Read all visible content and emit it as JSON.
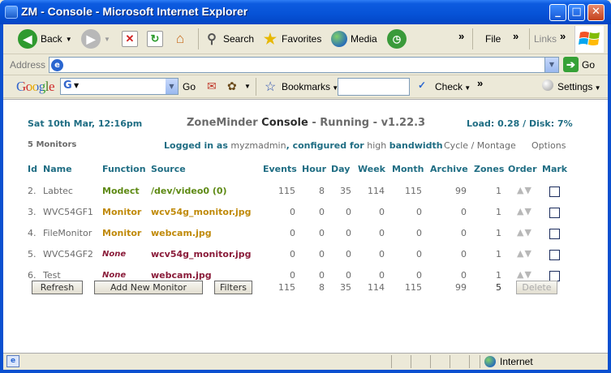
{
  "window": {
    "title": "ZM - Console - Microsoft Internet Explorer",
    "minimize": "_",
    "maximize": "□",
    "close": "✕"
  },
  "toolbar": {
    "back": "Back",
    "search": "Search",
    "favorites": "Favorites",
    "media": "Media",
    "file": "File",
    "links": "Links",
    "chevron": "»"
  },
  "address": {
    "label": "Address",
    "value": "",
    "go": "Go"
  },
  "google_bar": {
    "logo": "Google",
    "g_icon": "G",
    "go": "Go",
    "bookmarks": "Bookmarks",
    "check": "Check",
    "settings": "Settings",
    "chevron": "»"
  },
  "zm": {
    "datetime": "Sat 10th Mar, 12:16pm",
    "title_app": "ZoneMinder",
    "title_page": "Console",
    "title_sep": "-",
    "status": "Running",
    "version_sep": "-",
    "version": "v1.22.3",
    "load_label": "Load:",
    "load_value": "0.28",
    "slash": "/",
    "disk_label": "Disk:",
    "disk_value": "7%",
    "monitors_count": "5 Monitors",
    "logged_in_as": "Logged in as",
    "user": "myzmadmin",
    "configured_for": ", configured for",
    "bandwidth": "high",
    "bandwidth_suffix": "bandwidth",
    "cycle": "Cycle",
    "montage": "Montage",
    "options": "Options"
  },
  "table": {
    "headers": {
      "id": "Id",
      "name": "Name",
      "function": "Function",
      "source": "Source",
      "events": "Events",
      "hour": "Hour",
      "day": "Day",
      "week": "Week",
      "month": "Month",
      "archive": "Archive",
      "zones": "Zones",
      "order": "Order",
      "mark": "Mark"
    },
    "rows": [
      {
        "id": "2.",
        "name": "Labtec",
        "function": "Modect",
        "source": "/dev/video0 (0)",
        "events": "115",
        "hour": "8",
        "day": "35",
        "week": "114",
        "month": "115",
        "archive": "99",
        "zones": "1",
        "order": "▲▼"
      },
      {
        "id": "3.",
        "name": "WVC54GF1",
        "function": "Monitor",
        "source": "wcv54g_monitor.jpg",
        "events": "0",
        "hour": "0",
        "day": "0",
        "week": "0",
        "month": "0",
        "archive": "0",
        "zones": "1",
        "order": "▲▼"
      },
      {
        "id": "4.",
        "name": "FileMonitor",
        "function": "Monitor",
        "source": "webcam.jpg",
        "events": "0",
        "hour": "0",
        "day": "0",
        "week": "0",
        "month": "0",
        "archive": "0",
        "zones": "1",
        "order": "▲▼"
      },
      {
        "id": "5.",
        "name": "WVC54GF2",
        "function": "None",
        "source": "wcv54g_monitor.jpg",
        "events": "0",
        "hour": "0",
        "day": "0",
        "week": "0",
        "month": "0",
        "archive": "0",
        "zones": "1",
        "order": "▲▼"
      },
      {
        "id": "6.",
        "name": "Test",
        "function": "None",
        "source": "webcam.jpg",
        "events": "0",
        "hour": "0",
        "day": "0",
        "week": "0",
        "month": "0",
        "archive": "0",
        "zones": "1",
        "order": "▲▼"
      }
    ],
    "totals": {
      "events": "115",
      "hour": "8",
      "day": "35",
      "week": "114",
      "month": "115",
      "archive": "99",
      "zones": "5"
    },
    "buttons": {
      "refresh": "Refresh",
      "add": "Add New Monitor",
      "filters": "Filters",
      "delete": "Delete"
    }
  },
  "statusbar": {
    "zone": "Internet"
  },
  "colors": {
    "title_blue": "#0652d6",
    "zm_teal": "#1f6d83",
    "modect_green": "#5e8a14",
    "monitor_orange": "#c08a0a",
    "none_red": "#8a1c3a"
  }
}
